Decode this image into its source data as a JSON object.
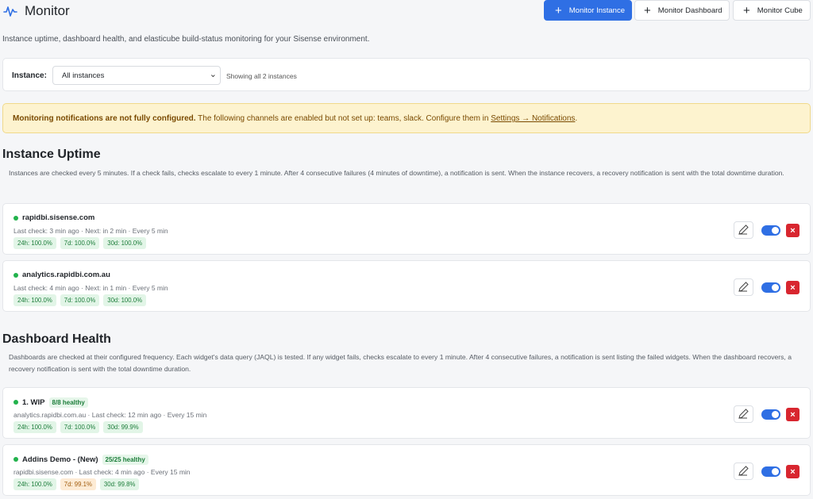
{
  "app": {
    "title": "Monitor",
    "icon": "pulse-icon"
  },
  "header_buttons": [
    {
      "label": "Monitor Instance",
      "icon": "plus-icon"
    },
    {
      "label": "Monitor Dashboard",
      "icon": "plus-icon"
    },
    {
      "label": "Monitor Cube",
      "icon": "plus-icon"
    }
  ],
  "subtitle": "Instance uptime, dashboard health, and elasticube build-status monitoring for your Sisense environment.",
  "filter": {
    "label": "Instance:",
    "selected": "All instances",
    "count_text": "Showing all 2 instances"
  },
  "banner": {
    "bold": "Monitoring notifications are not fully configured.",
    "text": " The following channels are enabled but not set up: teams, slack. Configure them in ",
    "link": "Settings → Notifications",
    "end": "."
  },
  "sections": {
    "instance": {
      "title": "Instance Uptime",
      "desc": "Instances are checked every 5 minutes. If a check fails, checks escalate to every 1 minute. After 4 consecutive failures (4 minutes of downtime), a notification is sent. When the instance recovers, a recovery notification is sent with the total downtime duration."
    },
    "dashboard": {
      "title": "Dashboard Health",
      "desc": "Dashboards are checked at their configured frequency. Each widget's data query (JAQL) is tested. If any widget fails, checks escalate to every 1 minute. After 4 consecutive failures, a notification is sent listing the failed widgets. When the dashboard recovers, a recovery notification is sent with the total downtime duration."
    }
  },
  "instances": [
    {
      "name": "rapidbi.sisense.com",
      "meta": "Last check: 3 min ago · Next: in 2 min · Every 5 min",
      "badges": [
        "24h: 100.0%",
        "7d: 100.0%",
        "30d: 100.0%"
      ]
    },
    {
      "name": "analytics.rapidbi.com.au",
      "meta": "Last check: 4 min ago · Next: in 1 min · Every 5 min",
      "badges": [
        "24h: 100.0%",
        "7d: 100.0%",
        "30d: 100.0%"
      ]
    }
  ],
  "dashboards": [
    {
      "name": "1. WIP",
      "health": "8/8 healthy",
      "meta": "analytics.rapidbi.com.au · Last check: 12 min ago · Every 15 min",
      "badges": [
        "24h: 100.0%",
        "7d: 100.0%",
        "30d: 99.9%"
      ]
    },
    {
      "name": "Addins Demo - (New)",
      "health": "25/25 healthy",
      "meta": "rapidbi.sisense.com · Last check: 4 min ago · Every 15 min",
      "badges": [
        "24h: 100.0%",
        "7d: 99.1%",
        "30d: 99.8%"
      ]
    }
  ],
  "icons": {
    "edit": "pencil-icon",
    "delete": "close-icon",
    "status": "status-dot-icon"
  },
  "colors": {
    "primary": "#2f6fe4",
    "success": "#22b24c",
    "danger": "#d8262f",
    "warning_bg": "#fdf3cf"
  }
}
